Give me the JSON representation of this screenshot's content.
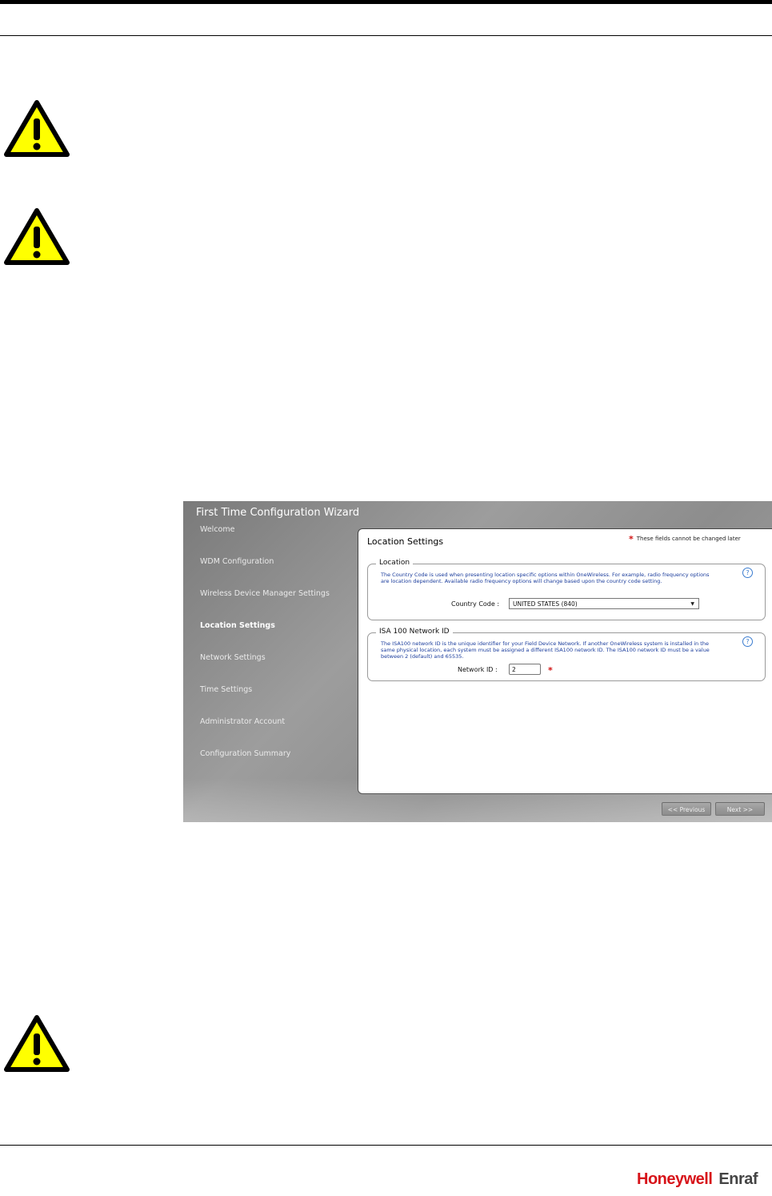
{
  "wizard": {
    "title": "First Time Configuration Wizard",
    "nav": [
      {
        "label": "Welcome"
      },
      {
        "label": "WDM Configuration"
      },
      {
        "label": "Wireless Device Manager Settings"
      },
      {
        "label": "Location Settings",
        "active": true
      },
      {
        "label": "Network Settings"
      },
      {
        "label": "Time Settings"
      },
      {
        "label": "Administrator Account"
      },
      {
        "label": "Configuration Summary"
      }
    ],
    "panel": {
      "title": "Location Settings",
      "required_note": "These fields cannot be changed later",
      "location": {
        "legend": "Location",
        "description": "The Country Code is used when presenting location specific options within OneWireless. For example, radio frequency options are location dependent. Available radio frequency options will change based upon the country code setting.",
        "country_code_label": "Country Code :",
        "country_code_value": "UNITED STATES (840)"
      },
      "isa": {
        "legend": "ISA 100 Network ID",
        "description": "The ISA100 network ID is the unique identifier for your Field Device Network. If another OneWireless system is installed in the same physical location, each system must be assigned a different ISA100 network ID. The ISA100 network ID must be a value between 2 (default) and 65535.",
        "network_id_label": "Network ID :",
        "network_id_value": "2"
      }
    },
    "buttons": {
      "previous": "<< Previous",
      "next": "Next >>"
    }
  },
  "footer": {
    "brand_primary": "Honeywell",
    "brand_secondary": "Enraf"
  },
  "icons": {
    "warning_fill": "#ffff00",
    "warning_stroke": "#000000"
  }
}
